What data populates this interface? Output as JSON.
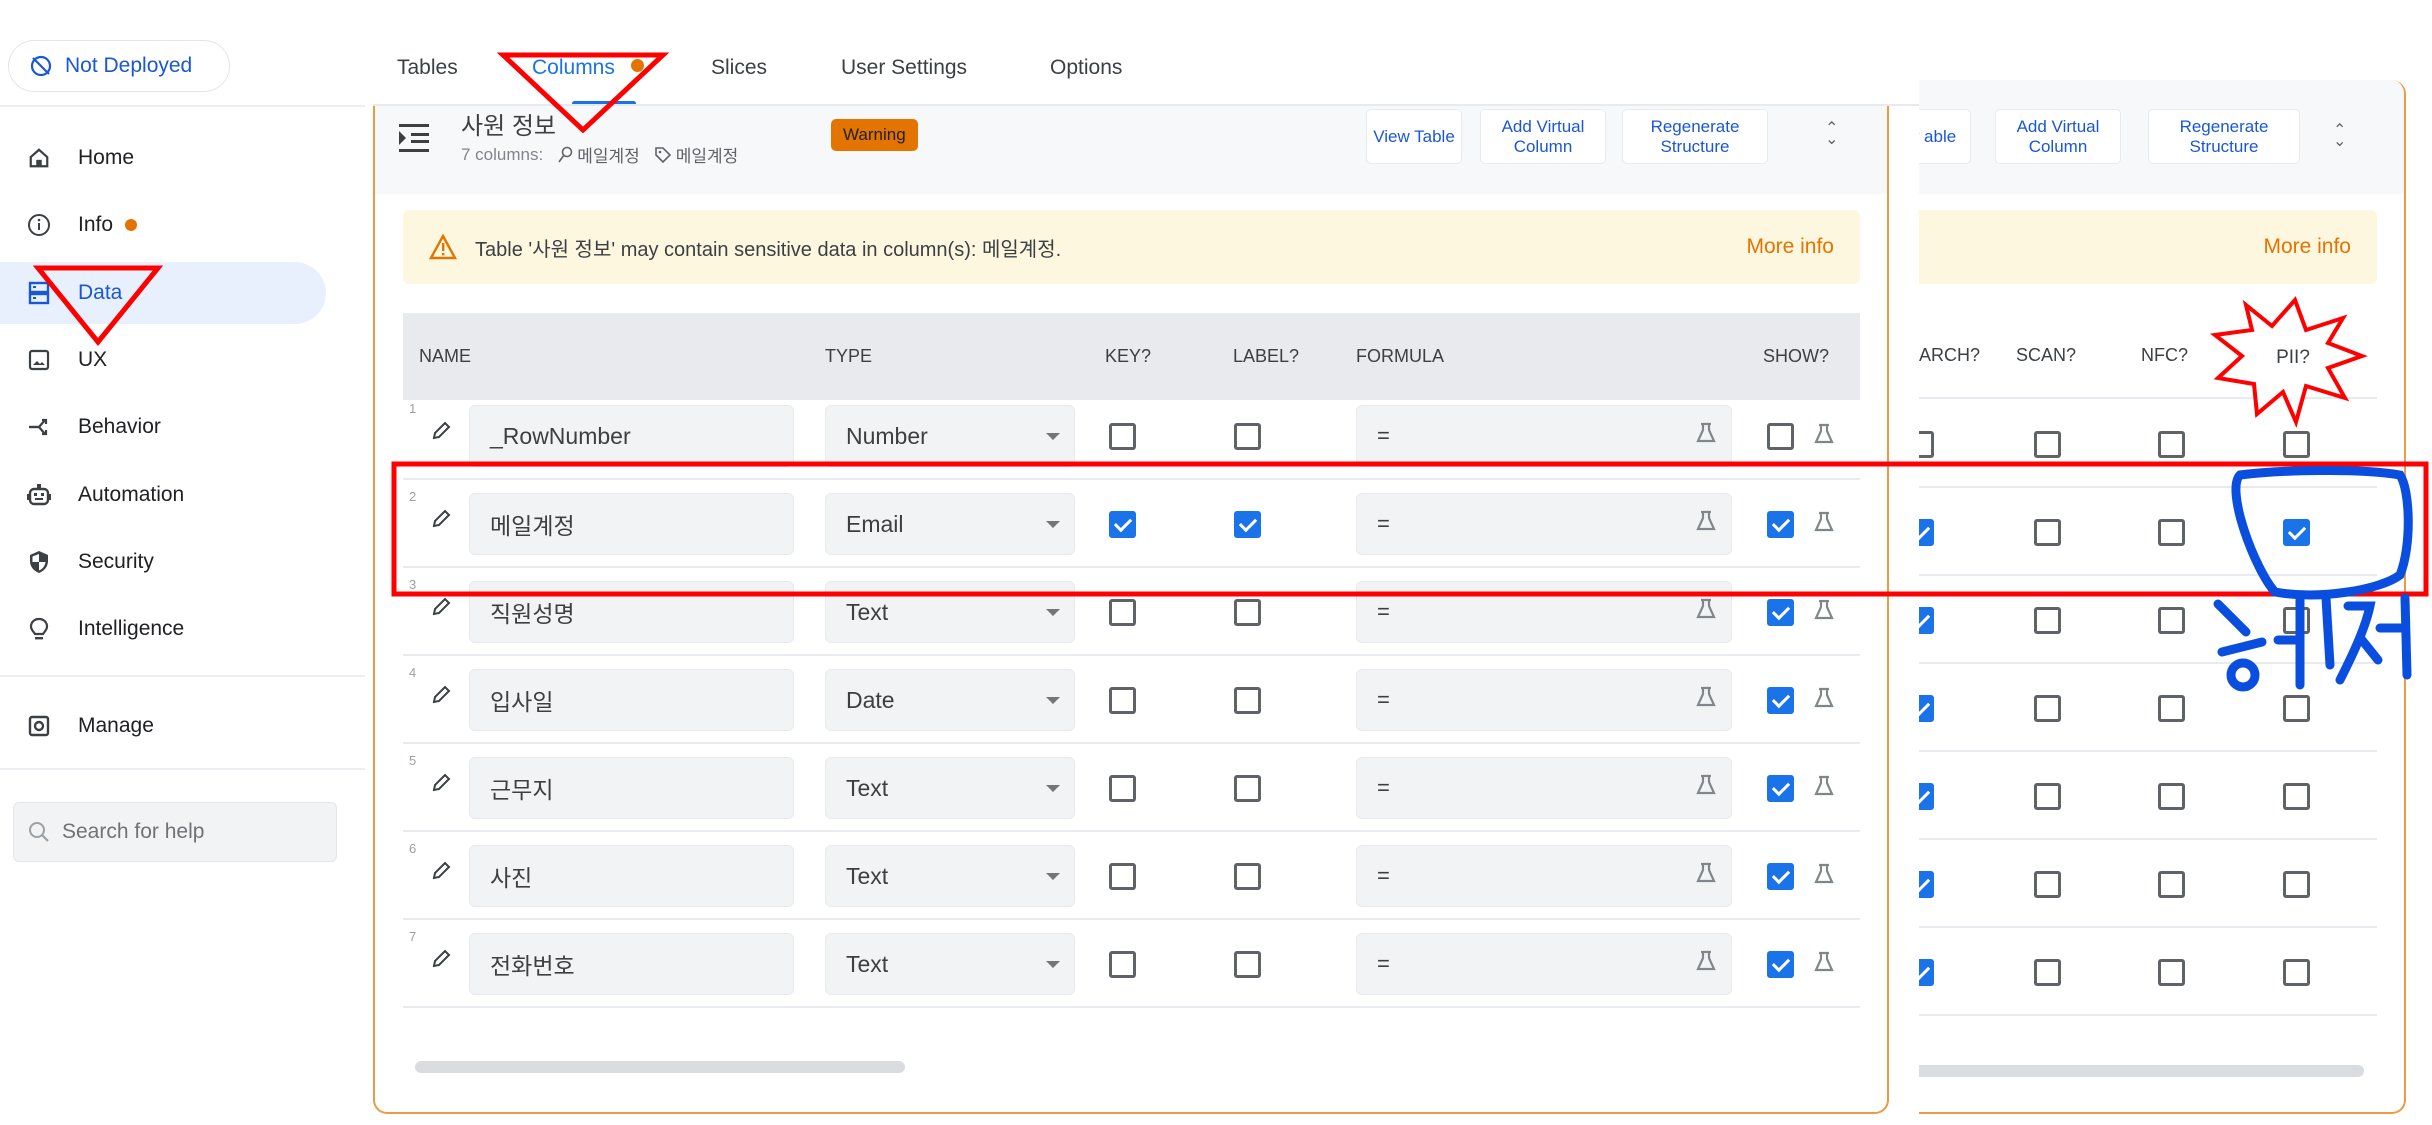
{
  "deploy_status": {
    "label": "Not Deployed",
    "icon": "cloud-off-icon"
  },
  "sidebar": {
    "items": [
      {
        "label": "Home",
        "icon": "home-icon"
      },
      {
        "label": "Info",
        "icon": "info-icon",
        "has_dot": true
      },
      {
        "label": "Data",
        "icon": "data-icon",
        "active": true
      },
      {
        "label": "UX",
        "icon": "image-icon"
      },
      {
        "label": "Behavior",
        "icon": "behavior-icon"
      },
      {
        "label": "Automation",
        "icon": "robot-icon"
      },
      {
        "label": "Security",
        "icon": "shield-icon"
      },
      {
        "label": "Intelligence",
        "icon": "lightbulb-icon"
      },
      {
        "label": "Manage",
        "icon": "manage-icon"
      }
    ],
    "search_placeholder": "Search for help"
  },
  "tabs": [
    {
      "label": "Tables"
    },
    {
      "label": "Columns",
      "active": true,
      "has_dot": true
    },
    {
      "label": "Slices"
    },
    {
      "label": "User Settings"
    },
    {
      "label": "Options"
    }
  ],
  "table": {
    "title": "사원 정보",
    "column_count": "7 columns:",
    "key_column": "메일계정",
    "label_column": "메일계정",
    "badge": "Warning",
    "buttons": {
      "view_table": "View Table",
      "view_table_partial": "iew able",
      "add_virtual_column": "Add Virtual Column",
      "regenerate_structure": "Regenerate Structure"
    },
    "alert": {
      "message": "Table '사원 정보' may contain sensitive data in column(s): 메일계정.",
      "link": "More info"
    },
    "headers": {
      "name": "NAME",
      "type": "TYPE",
      "key": "KEY?",
      "label": "LABEL?",
      "formula": "FORMULA",
      "show": "SHOW?",
      "search_partial": "ARCH?",
      "scan": "SCAN?",
      "nfc": "NFC?",
      "pii": "PII?"
    },
    "rows": [
      {
        "num": "1",
        "name": "_RowNumber",
        "type": "Number",
        "key": false,
        "label": false,
        "formula": "=",
        "show": false,
        "search": false,
        "scan": false,
        "nfc": false,
        "pii": false
      },
      {
        "num": "2",
        "name": "메일계정",
        "type": "Email",
        "key": true,
        "label": true,
        "formula": "=",
        "show": true,
        "search": true,
        "scan": false,
        "nfc": false,
        "pii": true
      },
      {
        "num": "3",
        "name": "직원성명",
        "type": "Text",
        "key": false,
        "label": false,
        "formula": "=",
        "show": true,
        "search": true,
        "scan": false,
        "nfc": false,
        "pii": false
      },
      {
        "num": "4",
        "name": "입사일",
        "type": "Date",
        "key": false,
        "label": false,
        "formula": "=",
        "show": true,
        "search": true,
        "scan": false,
        "nfc": false,
        "pii": false
      },
      {
        "num": "5",
        "name": "근무지",
        "type": "Text",
        "key": false,
        "label": false,
        "formula": "=",
        "show": true,
        "search": true,
        "scan": false,
        "nfc": false,
        "pii": false
      },
      {
        "num": "6",
        "name": "사진",
        "type": "Text",
        "key": false,
        "label": false,
        "formula": "=",
        "show": true,
        "search": true,
        "scan": false,
        "nfc": false,
        "pii": false
      },
      {
        "num": "7",
        "name": "전화번호",
        "type": "Text",
        "key": false,
        "label": false,
        "formula": "=",
        "show": true,
        "search": true,
        "scan": false,
        "nfc": false,
        "pii": false
      }
    ]
  },
  "annotations": {
    "handwritten_note": "해제",
    "colors": {
      "red": "#ff0000",
      "blue": "#0a4ee0"
    }
  },
  "colors": {
    "accent": "#1a73e8",
    "warning": "#e37400",
    "panel_border": "#eb9a45"
  }
}
